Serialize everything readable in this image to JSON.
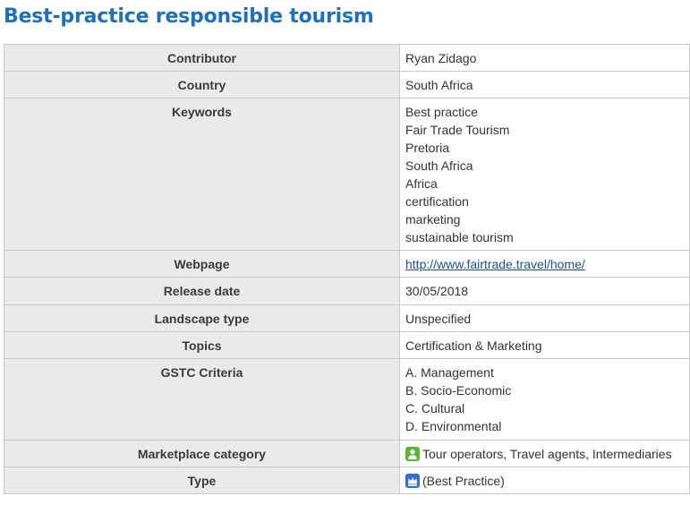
{
  "page": {
    "title": "Best-practice responsible tourism"
  },
  "rows": {
    "contributor": {
      "label": "Contributor",
      "value": "Ryan Zidago"
    },
    "country": {
      "label": "Country",
      "value": "South Africa"
    },
    "keywords": {
      "label": "Keywords",
      "values": [
        "Best practice",
        "Fair Trade Tourism",
        "Pretoria",
        "South Africa",
        "Africa",
        "certification",
        "marketing",
        "sustainable tourism"
      ]
    },
    "webpage": {
      "label": "Webpage",
      "value": "http://www.fairtrade.travel/home/"
    },
    "release_date": {
      "label": "Release date",
      "value": "30/05/2018"
    },
    "landscape_type": {
      "label": "Landscape type",
      "value": "Unspecified"
    },
    "topics": {
      "label": "Topics",
      "value": "Certification & Marketing"
    },
    "gstc_criteria": {
      "label": "GSTC Criteria",
      "values": [
        "A. Management",
        "B. Socio-Economic",
        "C. Cultural",
        "D. Environmental"
      ]
    },
    "marketplace_category": {
      "label": "Marketplace category",
      "value": "Tour operators, Travel agents, Intermediaries",
      "icon": "person-icon",
      "icon_color": "#5cb531"
    },
    "type": {
      "label": "Type",
      "value": "(Best Practice)",
      "icon": "crown-icon",
      "icon_color": "#2f6fd6"
    }
  }
}
